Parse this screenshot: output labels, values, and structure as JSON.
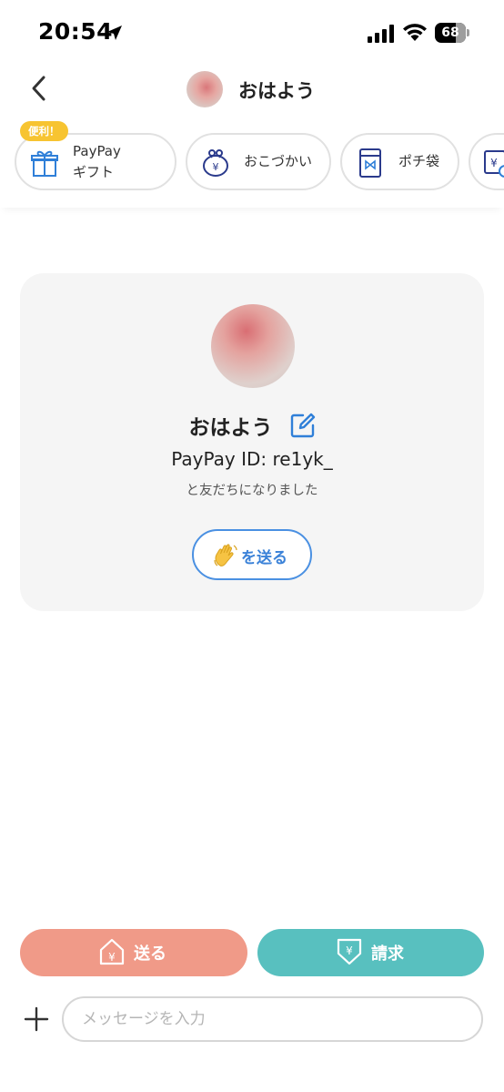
{
  "status_bar": {
    "time": "20:54",
    "battery_level": "68",
    "battery_fraction": 0.68,
    "icons": [
      "location-arrow-icon",
      "signal-icon",
      "wifi-icon",
      "battery-icon"
    ]
  },
  "header": {
    "title": "おはよう",
    "back_icon": "chevron-left-icon"
  },
  "quick_actions": [
    {
      "label_line1": "PayPay",
      "label_line2": "ギフト",
      "badge": "便利！",
      "icon": "gift-icon"
    },
    {
      "label": "おこづかい",
      "icon": "coin-purse-icon"
    },
    {
      "label": "ポチ袋",
      "icon": "envelope-icon"
    },
    {
      "label": "",
      "icon": "yen-receipt-icon"
    }
  ],
  "friend_card": {
    "name": "おはよう",
    "paypay_id": "PayPay ID: re1yk_",
    "subtitle": "と友だちになりました",
    "wave_button_label": "を送る",
    "wave_emoji": "👋"
  },
  "actions": {
    "send_label": "送る",
    "request_label": "請求",
    "send_color": "#f09a88",
    "request_color": "#58c0bf"
  },
  "message_input": {
    "placeholder": "メッセージを入力",
    "value": ""
  },
  "colors": {
    "accent_blue": "#3b82d8",
    "badge_yellow": "#f7c431",
    "icon_navy": "#2a3a8c"
  }
}
